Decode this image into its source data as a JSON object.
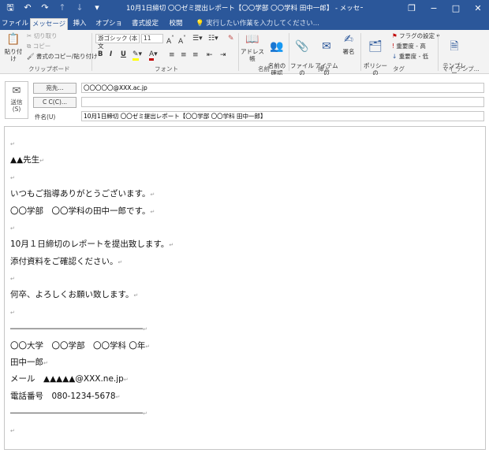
{
  "titlebar": {
    "title": "10月1日締切 〇〇ゼミ提出レポート【〇〇学部 〇〇学科 田中一郎】 - メッセージ (HTML 形式)",
    "qat": [
      "save-icon",
      "undo-icon",
      "redo-icon",
      "up-icon",
      "down-icon",
      "customize-icon"
    ],
    "controls": {
      "restore": "❐",
      "minimize": "−",
      "maximize": "□",
      "close": "✕"
    }
  },
  "tabs": {
    "items": [
      "ファイル",
      "メッセージ",
      "挿入",
      "オプション",
      "書式設定",
      "校閲"
    ],
    "active_index": 1,
    "tellme": "実行したい作業を入力してください..."
  },
  "ribbon": {
    "clipboard": {
      "paste": "貼り付け",
      "cut": "切り取り",
      "copy": "コピー",
      "format_painter": "書式のコピー/貼り付け",
      "group_label": "クリップボード"
    },
    "font": {
      "font_name": "游ゴシック (本文",
      "font_size": "11",
      "bold": "B",
      "italic": "I",
      "underline": "U",
      "group_label": "フォント"
    },
    "names": {
      "address_book": "アドレス帳",
      "check_names": "名前の\n確認",
      "group_label": "名前"
    },
    "include": {
      "attach_file": "ファイルの\n添付",
      "attach_item": "アイテムの\n添付",
      "signature": "署名",
      "group_label": "挿入"
    },
    "tags": {
      "policy": "ポリシーの\n割り当て",
      "follow_up": "フラグの設定",
      "high_importance": "重要度 - 高",
      "low_importance": "重要度 - 低",
      "group_label": "タグ"
    },
    "templates": {
      "view_templates": "テンプレー\nトを表示",
      "group_label": "マイ テンプ..."
    }
  },
  "header": {
    "send": "送信\n(S)",
    "to_button": "宛先...",
    "cc_button": "C C(C)...",
    "subject_label": "件名(U)",
    "to_value": "〇〇〇〇〇@XXX.ac.jp",
    "cc_value": "",
    "subject_value": "10月1日締切 〇〇ゼミ提出レポート【〇〇学部 〇〇学科 田中一郎】"
  },
  "body": {
    "lines": [
      "",
      "▲▲先生",
      "",
      "いつもご指導ありがとうございます。",
      "〇〇学部　〇〇学科の田中一郎です。",
      "",
      "10月１日締切のレポートを提出致します。",
      "添付資料をご確認ください。",
      "",
      "何卒、よろしくお願い致します。",
      "",
      "――――――――――――――――",
      "〇〇大学　〇〇学部　〇〇学科 〇年",
      "田中一郎",
      "メール　▲▲▲▲▲@XXX.ne.jp",
      "電話番号　080-1234-5678",
      "――――――――――――――――",
      ""
    ],
    "return_mark": "↵"
  }
}
